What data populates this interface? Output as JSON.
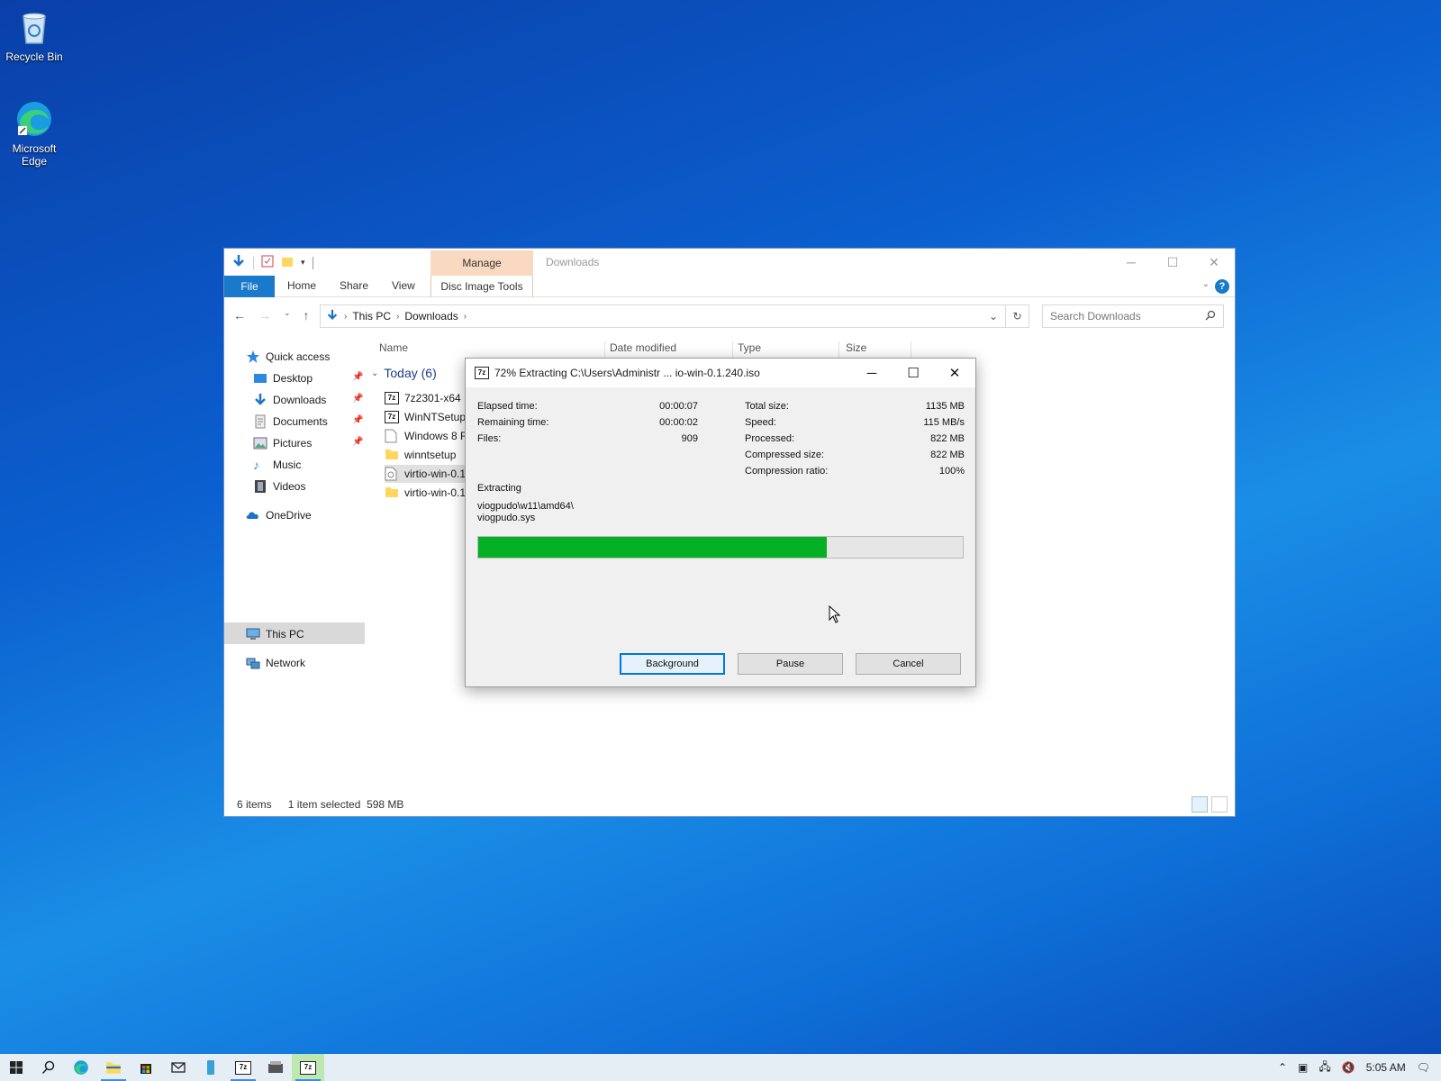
{
  "desktop": {
    "icons": [
      {
        "label": "Recycle Bin",
        "icon": "recycle-bin-icon"
      },
      {
        "label": "Microsoft Edge",
        "icon": "edge-icon"
      }
    ]
  },
  "explorer": {
    "context_tab": "Manage",
    "title": "Downloads",
    "ribbon_tabs": {
      "file": "File",
      "home": "Home",
      "share": "Share",
      "view": "View",
      "disc": "Disc Image Tools"
    },
    "breadcrumb": {
      "root": "This PC",
      "current": "Downloads"
    },
    "search_placeholder": "Search Downloads",
    "nav": {
      "quick_access": "Quick access",
      "desktop": "Desktop",
      "downloads": "Downloads",
      "documents": "Documents",
      "pictures": "Pictures",
      "music": "Music",
      "videos": "Videos",
      "onedrive": "OneDrive",
      "this_pc": "This PC",
      "network": "Network"
    },
    "columns": {
      "name": "Name",
      "date": "Date modified",
      "type": "Type",
      "size": "Size"
    },
    "group": "Today (6)",
    "files": [
      {
        "name": "7z2301-x64",
        "icon": "7zip-icon"
      },
      {
        "name": "WinNTSetup_",
        "icon": "7zip-icon"
      },
      {
        "name": "Windows 8 Re",
        "icon": "document-icon"
      },
      {
        "name": "winntsetup",
        "icon": "folder-icon"
      },
      {
        "name": "virtio-win-0.1",
        "icon": "disc-image-icon"
      },
      {
        "name": "virtio-win-0.1",
        "icon": "folder-icon"
      }
    ],
    "status": {
      "count": "6 items",
      "selection": "1 item selected  598 MB"
    }
  },
  "dialog": {
    "title": "72% Extracting C:\\Users\\Administr ... io-win-0.1.240.iso",
    "progress": 0.72,
    "left_stats": [
      {
        "label": "Elapsed time:",
        "value": "00:00:07"
      },
      {
        "label": "Remaining time:",
        "value": "00:00:02"
      },
      {
        "label": "Files:",
        "value": "909"
      }
    ],
    "right_stats": [
      {
        "label": "Total size:",
        "value": "1135 MB"
      },
      {
        "label": "Speed:",
        "value": "115 MB/s"
      },
      {
        "label": "Processed:",
        "value": "822 MB"
      },
      {
        "label": "Compressed size:",
        "value": "822 MB"
      },
      {
        "label": "Compression ratio:",
        "value": "100%"
      }
    ],
    "action": "Extracting",
    "path_line1": "viogpudo\\w11\\amd64\\",
    "path_line2": "viogpudo.sys",
    "buttons": {
      "background": "Background",
      "pause": "Pause",
      "cancel": "Cancel"
    }
  },
  "taskbar": {
    "clock": "5:05 AM"
  },
  "colors": {
    "accent": "#0078d7",
    "progress": "#06b025",
    "manage_tab": "#f9d9c0",
    "file_tab": "#1979ca"
  }
}
